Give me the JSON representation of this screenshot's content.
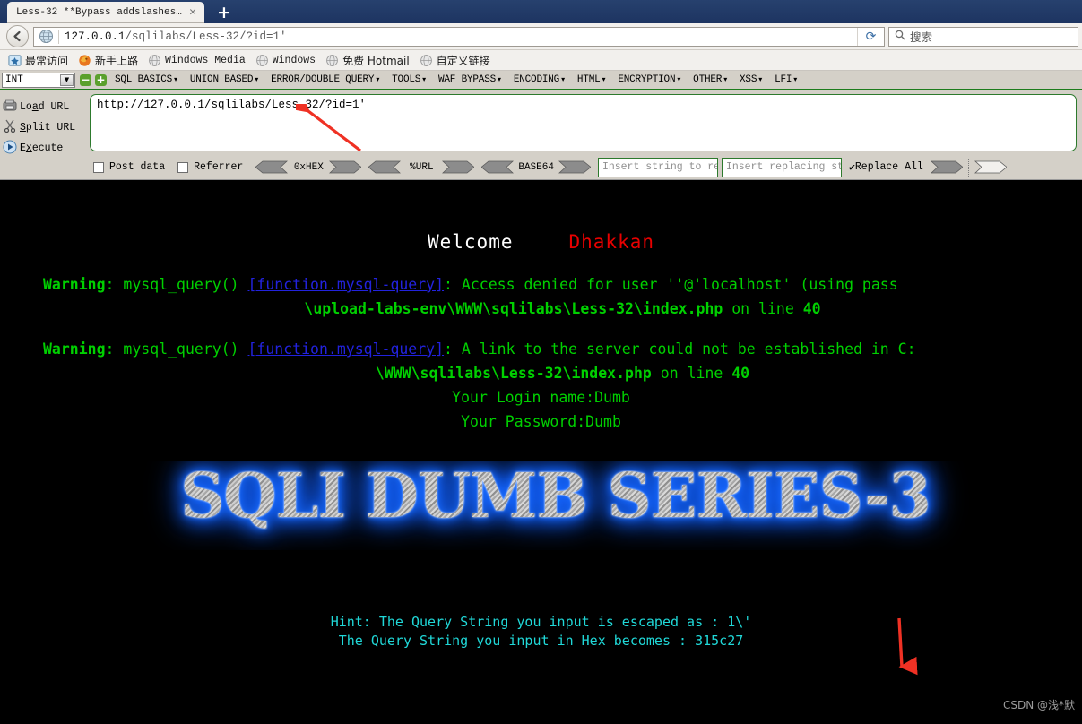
{
  "browser": {
    "tab": {
      "title": "Less-32 **Bypass addslashes···",
      "close_label": "✕"
    },
    "newtab_label": "+",
    "back_label": "←",
    "url": {
      "host": "127.0.0.1",
      "path": "/sqlilabs/Less-32/?id=1'",
      "go_label": "⟳"
    },
    "search": {
      "icon_label": "⚲",
      "placeholder": "搜索"
    },
    "bookmarks": [
      {
        "label": "最常访问",
        "lang": "cn",
        "icon": "star-folder-icon"
      },
      {
        "label": "新手上路",
        "lang": "cn",
        "icon": "firefox-icon"
      },
      {
        "label": "Windows Media",
        "lang": "en",
        "icon": "globe-icon"
      },
      {
        "label": "Windows",
        "lang": "en",
        "icon": "globe-icon"
      },
      {
        "label": "免费 Hotmail",
        "lang": "cn",
        "icon": "globe-icon"
      },
      {
        "label": "自定义链接",
        "lang": "cn",
        "icon": "globe-icon"
      }
    ]
  },
  "hackbar": {
    "type_select": "INT",
    "remove_label": "−",
    "add_label": "+",
    "menus": [
      "SQL BASICS",
      "UNION BASED",
      "ERROR/DOUBLE QUERY",
      "TOOLS",
      "WAF BYPASS",
      "ENCODING",
      "HTML",
      "ENCRYPTION",
      "OTHER",
      "XSS",
      "LFI"
    ],
    "actions": [
      {
        "name": "load-url",
        "pre": "Lo",
        "key": "a",
        "post": "d URL",
        "icon": "load-url-icon"
      },
      {
        "name": "split-url",
        "pre": "",
        "key": "S",
        "post": "plit URL",
        "icon": "scissors-icon"
      },
      {
        "name": "execute",
        "pre": "E",
        "key": "x",
        "post": "ecute",
        "icon": "play-icon"
      }
    ],
    "url_value": "http://127.0.0.1/sqlilabs/Less-32/?id=1'",
    "post_data_label": "Post data",
    "referrer_label": "Referrer",
    "encoders": [
      "0xHEX",
      "%URL",
      "BASE64"
    ],
    "replace_from_placeholder": "Insert string to repla",
    "replace_to_placeholder": "Insert replacing string",
    "replace_all_label": "Replace All",
    "replace_all_checked": true
  },
  "page": {
    "welcome": "Welcome",
    "author": "Dhakkan",
    "warnings": [
      {
        "label": "Warning",
        "func": ": mysql_query()",
        "link": "[function.mysql-query]",
        "message": ": Access denied for user ''@'localhost' (using pass",
        "path_prefix": "\\upload-labs-env\\",
        "path_www": "WWW",
        "path_mid": "\\sqlilabs\\Less-32\\",
        "path_file": "index.php",
        "on_line_label": " on line ",
        "line_no": "40"
      },
      {
        "label": "Warning",
        "func": ": mysql_query()",
        "link": "[function.mysql-query]",
        "message": ": A link to the server could not be established in C:",
        "path_prefix": "\\",
        "path_www": "WWW",
        "path_mid": "\\sqlilabs\\Less-32\\",
        "path_file": "index.php",
        "on_line_label": " on line ",
        "line_no": "40"
      }
    ],
    "login_name": "Your Login name:Dumb",
    "password": "Your Password:Dumb",
    "logo_text": "SQLI DUMB SERIES-3",
    "hint_line1": "Hint: The Query String you input is escaped as : 1\\'",
    "hint_line2": "The Query String you input in Hex becomes : 315c27",
    "watermark": "CSDN @浅*默"
  },
  "colors": {
    "warning_green": "#00d000",
    "link_blue": "#2222dd",
    "hint_cyan": "#20d8d8",
    "author_red": "#e80000",
    "annotation_red": "#ef3124",
    "logo_glow": "#1565ff"
  }
}
